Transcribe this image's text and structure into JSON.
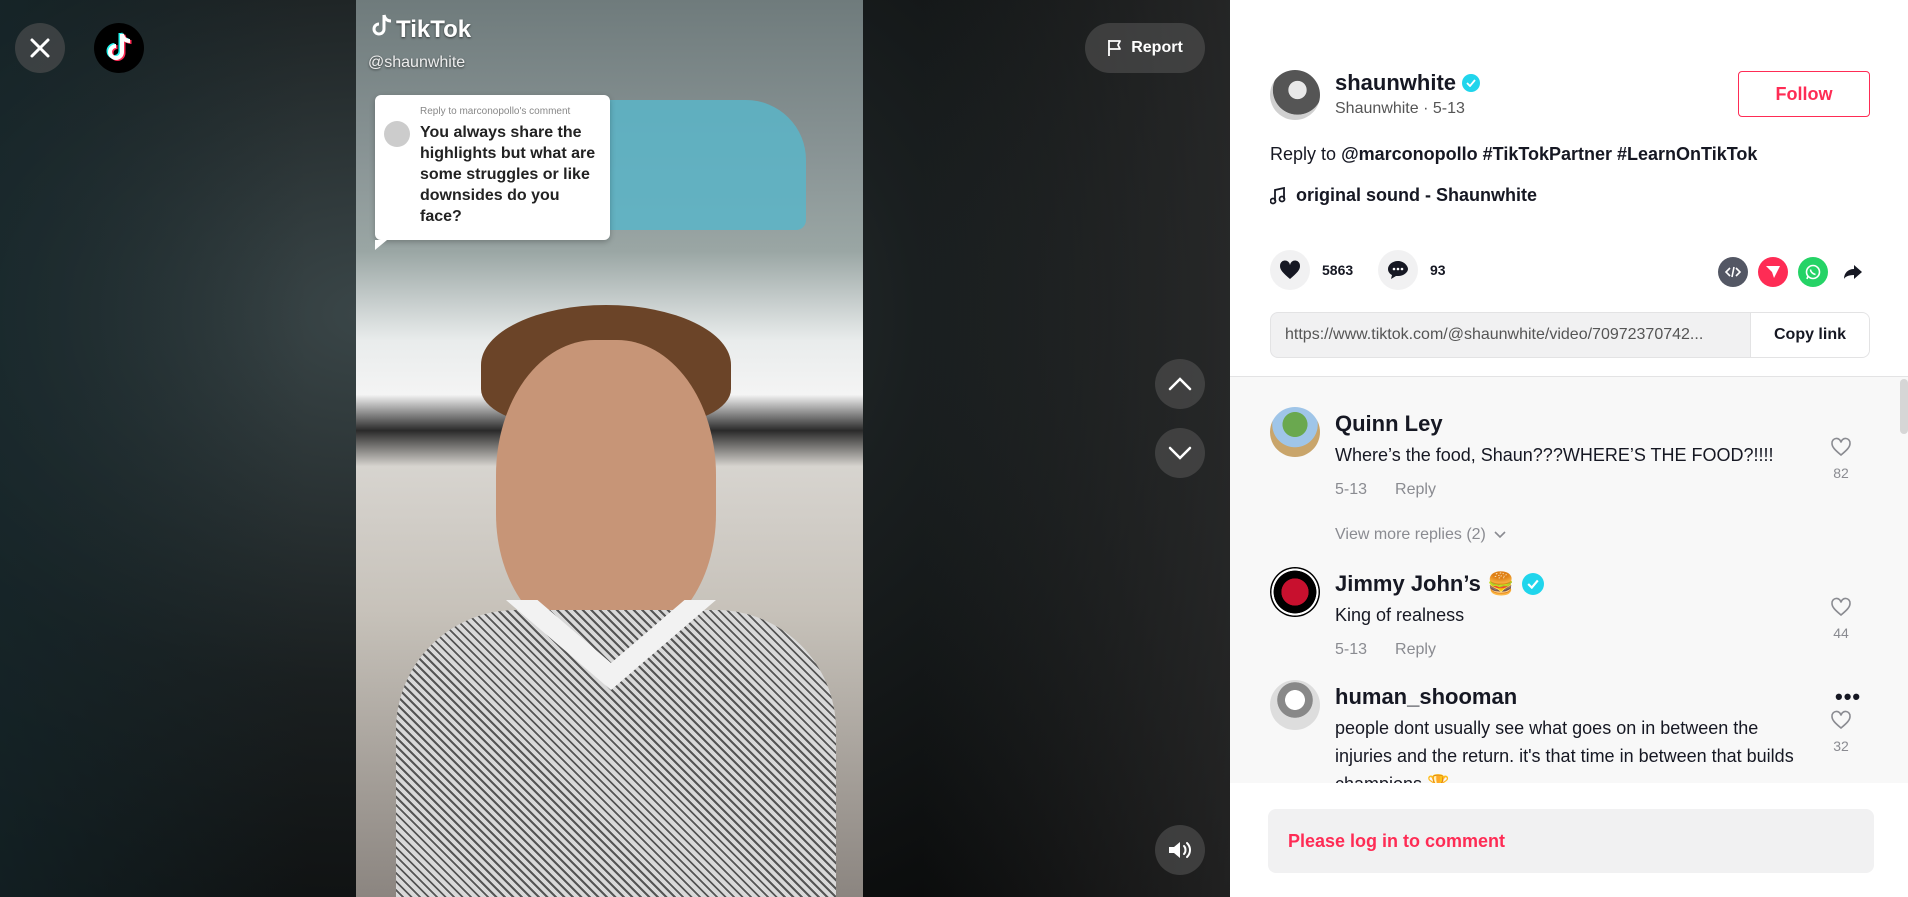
{
  "player": {
    "watermark": "TikTok",
    "watermark_handle": "@shaunwhite",
    "reply_card": {
      "meta": "Reply to marconopollo's comment",
      "text": "You always share the highlights but what are some struggles or like downsides do you face?"
    },
    "report_label": "Report"
  },
  "author": {
    "username": "shaunwhite",
    "display_and_date": "Shaunwhite · 5-13",
    "follow_label": "Follow"
  },
  "description": {
    "prefix": "Reply to",
    "mention": "@marconopollo",
    "tags": "#TikTokPartner #LearnOnTikTok"
  },
  "sound": "original sound - Shaunwhite",
  "stats": {
    "likes": "5863",
    "comments": "93"
  },
  "share": {
    "icons": [
      "embed-icon",
      "send-icon",
      "whatsapp-icon",
      "share-arrow-icon"
    ],
    "colors": {
      "embed": "#535764",
      "send": "#fe2c55",
      "whatsapp": "#25d366"
    }
  },
  "link": {
    "url": "https://www.tiktok.com/@shaunwhite/video/70972370742...",
    "copy_label": "Copy link"
  },
  "comments": [
    {
      "name": "Quinn Ley",
      "text": "Where’s the food, Shaun???WHERE’S THE FOOD?!!!!",
      "date": "5-13",
      "reply_label": "Reply",
      "likes": "82",
      "view_more": "View more replies (2)"
    },
    {
      "name": "Jimmy John’s 🍔",
      "text": "King of realness",
      "date": "5-13",
      "reply_label": "Reply",
      "likes": "44"
    },
    {
      "name": "human_shooman",
      "text": "people dont usually see what goes on in between the injuries and the return. it's that time in between that builds champions 🏆",
      "likes": "32"
    }
  ],
  "login_prompt": "Please log in to comment",
  "colors": {
    "accent": "#fe2c55",
    "verified": "#20d5ec"
  }
}
